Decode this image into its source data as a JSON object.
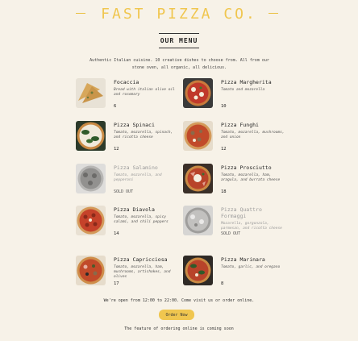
{
  "header": {
    "brand": "FAST PIZZA CO."
  },
  "menu": {
    "title": "OUR MENU",
    "intro": "Authentic Italian cuisine. 10 creative dishes to choose from. All from our stone oven, all organic, all delicious."
  },
  "pizzas": [
    {
      "name": "Focaccia",
      "ingredients": "Bread with italian olive oil and rosemary",
      "price": "6",
      "sold_out": false
    },
    {
      "name": "Pizza Margherita",
      "ingredients": "Tomato and mozarella",
      "price": "10",
      "sold_out": false
    },
    {
      "name": "Pizza Spinaci",
      "ingredients": "Tomato, mozarella, spinach, and ricotta cheese",
      "price": "12",
      "sold_out": false
    },
    {
      "name": "Pizza Funghi",
      "ingredients": "Tomato, mozarella, mushrooms, and onion",
      "price": "12",
      "sold_out": false
    },
    {
      "name": "Pizza Salamino",
      "ingredients": "Tomato, mozarella, and pepperoni",
      "price": "SOLD OUT",
      "sold_out": true
    },
    {
      "name": "Pizza Prosciutto",
      "ingredients": "Tomato, mozarella, ham, aragula, and burrata cheese",
      "price": "18",
      "sold_out": false
    },
    {
      "name": "Pizza Diavola",
      "ingredients": "Tomato, mozarella, spicy salami, and chili peppers",
      "price": "14",
      "sold_out": false
    },
    {
      "name": "Pizza Quattro Formaggi",
      "ingredients": "Mozarella, gorgonzola, parmesan, and ricotta cheese",
      "price": "SOLD OUT",
      "sold_out": true
    },
    {
      "name": "Pizza Capricciosa",
      "ingredients": "Tomato, mozarella, ham, mushrooms, artichokes, and olives",
      "price": "17",
      "sold_out": false
    },
    {
      "name": "Pizza Marinara",
      "ingredients": "Tomato, garlic, and oregano",
      "price": "8",
      "sold_out": false
    }
  ],
  "footer": {
    "open_text": "We're open from 12:00 to 22:00. Come visit us or order online.",
    "order_button": "Order Now",
    "coming_soon": "The feature of ordering online is coming soon"
  },
  "colors": {
    "background": "#f7f2e8",
    "accent": "#f0c64f"
  }
}
